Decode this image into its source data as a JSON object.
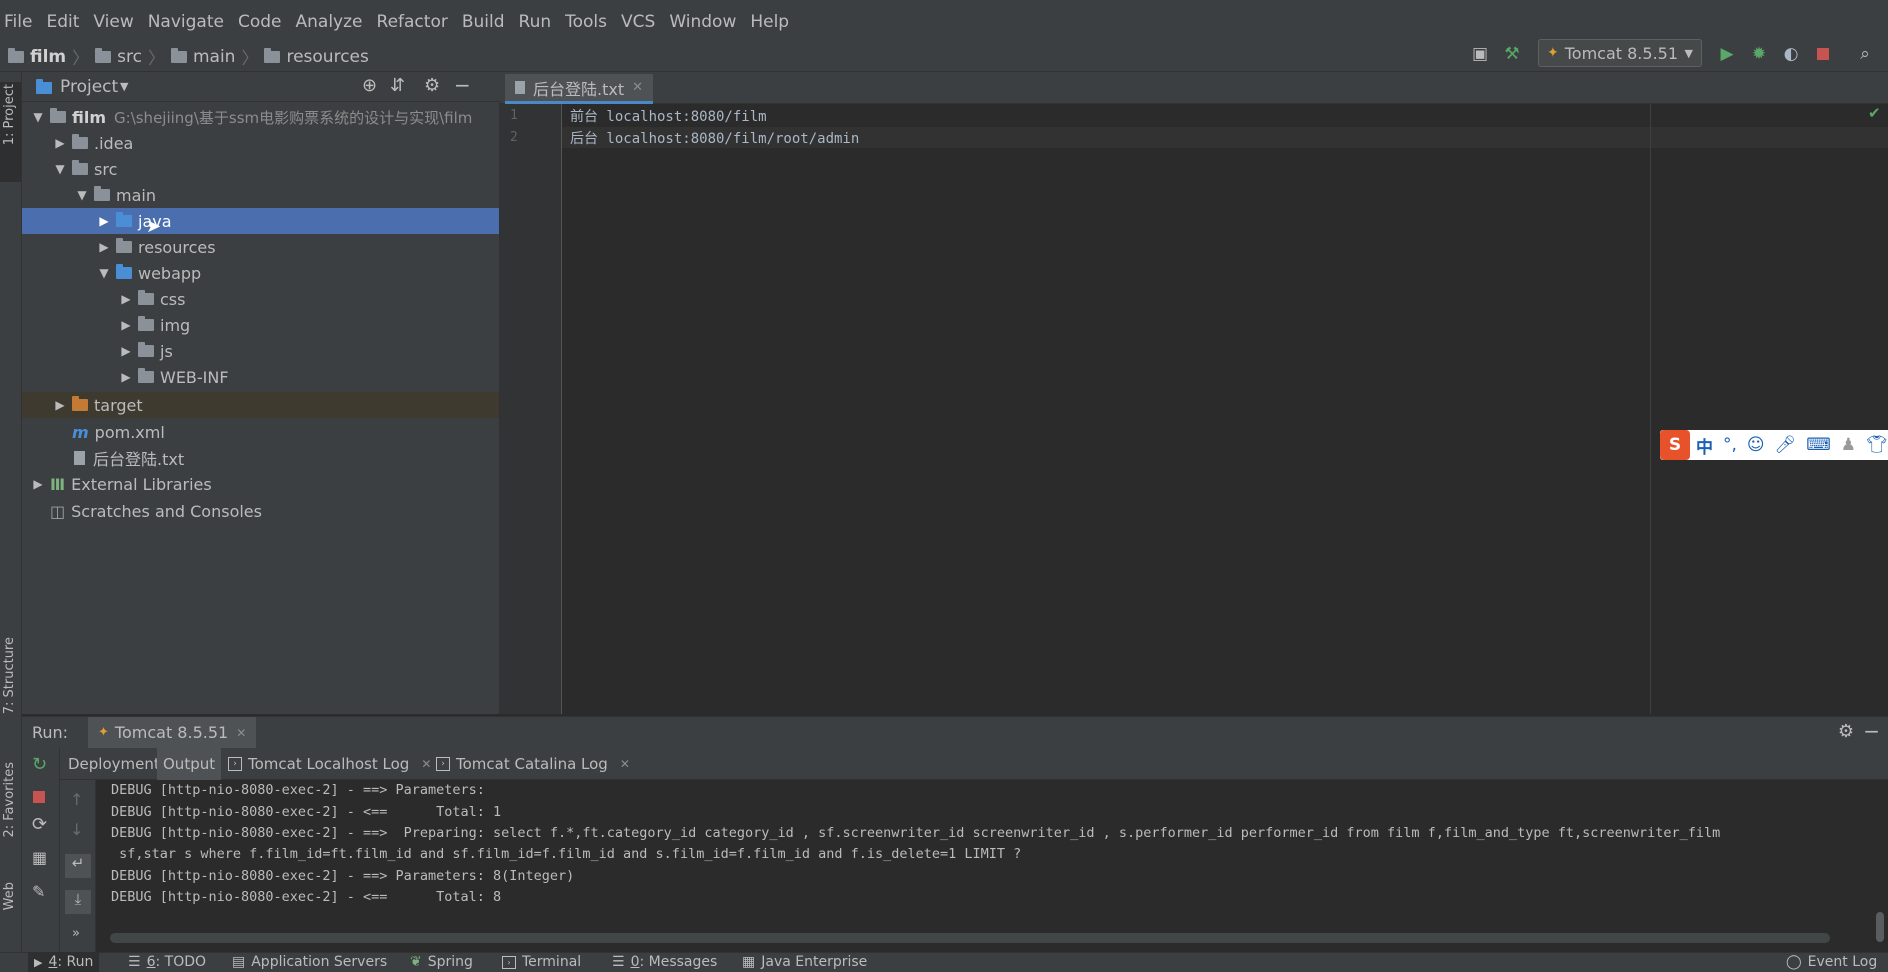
{
  "menu": [
    "File",
    "Edit",
    "View",
    "Navigate",
    "Code",
    "Analyze",
    "Refactor",
    "Build",
    "Run",
    "Tools",
    "VCS",
    "Window",
    "Help"
  ],
  "breadcrumb": [
    "film",
    "src",
    "main",
    "resources"
  ],
  "run_config": "Tomcat 8.5.51",
  "project": {
    "header": "Project",
    "root_name": "film",
    "root_path": "G:\\shejiing\\基于ssm电影购票系统的设计与实现\\film",
    "items": [
      ".idea",
      "src",
      "main",
      "java",
      "resources",
      "webapp",
      "css",
      "img",
      "js",
      "WEB-INF",
      "target",
      "pom.xml",
      "后台登陆.txt",
      "External Libraries",
      "Scratches and Consoles"
    ]
  },
  "editor": {
    "tab": "后台登陆.txt",
    "line_numbers": [
      "1",
      "2"
    ],
    "lines": [
      "前台 localhost:8080/film",
      "后台 localhost:8080/film/root/admin"
    ]
  },
  "left_stripe": [
    "1: Project",
    "7: Structure",
    "2: Favorites",
    "Web"
  ],
  "run": {
    "label": "Run:",
    "config_tab": "Tomcat 8.5.51",
    "tabs": [
      "Deployment",
      "Output",
      "Tomcat Localhost Log",
      "Tomcat Catalina Log"
    ],
    "console": [
      "DEBUG [http-nio-8080-exec-2] - ==> Parameters: ",
      "DEBUG [http-nio-8080-exec-2] - <==      Total: 1",
      "DEBUG [http-nio-8080-exec-2] - ==>  Preparing: select f.*,ft.category_id category_id , sf.screenwriter_id screenwriter_id , s.performer_id performer_id from film f,film_and_type ft,screenwriter_film",
      " sf,star s where f.film_id=ft.film_id and sf.film_id=f.film_id and s.film_id=f.film_id and f.is_delete=1 LIMIT ? ",
      "DEBUG [http-nio-8080-exec-2] - ==> Parameters: 8(Integer)",
      "DEBUG [http-nio-8080-exec-2] - <==      Total: 8"
    ]
  },
  "bottom_tabs": [
    {
      "prefix": "4",
      "label": ": Run"
    },
    {
      "prefix": "6",
      "label": ": TODO"
    },
    {
      "prefix": "",
      "label": "Application Servers"
    },
    {
      "prefix": "",
      "label": "Spring"
    },
    {
      "prefix": "",
      "label": "Terminal"
    },
    {
      "prefix": "0",
      "label": ": Messages"
    },
    {
      "prefix": "",
      "label": "Java Enterprise"
    }
  ],
  "event_log": "Event Log",
  "ime_text": "中",
  "colors": {
    "selection": "#4b6eaf",
    "run_green": "#59a869",
    "stop_red": "#c75450",
    "folder_blue": "#4a8fd6",
    "folder_orange": "#c27a34"
  }
}
